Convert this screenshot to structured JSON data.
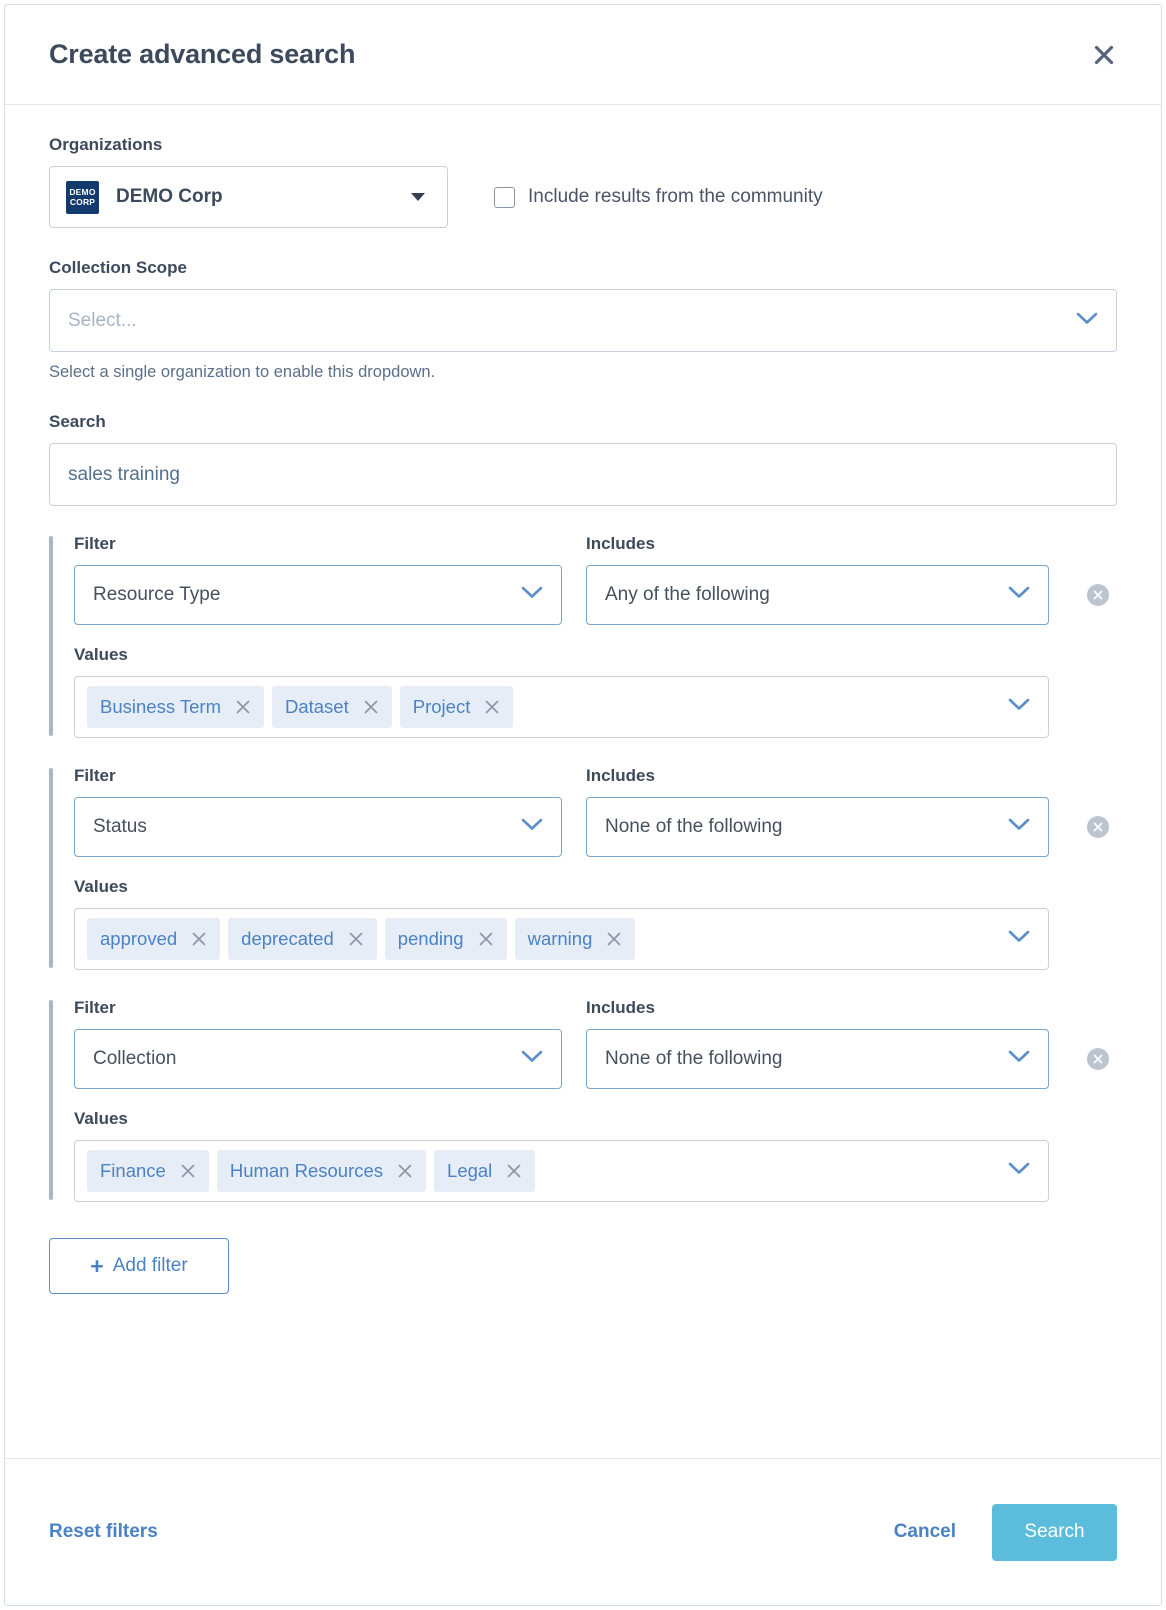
{
  "dialog": {
    "title": "Create advanced search",
    "close_icon": "close-icon"
  },
  "organizations": {
    "label": "Organizations",
    "selected": "DEMO Corp",
    "logo_line1": "DEMO",
    "logo_line2": "CORP",
    "logo_color": "#123a6b",
    "community_checkbox": {
      "label": "Include results from the community",
      "checked": false
    }
  },
  "collection_scope": {
    "label": "Collection Scope",
    "placeholder": "Select...",
    "value": "",
    "help_text": "Select a single organization to enable this dropdown."
  },
  "search": {
    "label": "Search",
    "value": "sales training"
  },
  "filters": {
    "filter_label": "Filter",
    "includes_label": "Includes",
    "values_label": "Values",
    "items": [
      {
        "filter": "Resource Type",
        "includes": "Any of the following",
        "values": [
          "Business Term",
          "Dataset",
          "Project"
        ]
      },
      {
        "filter": "Status",
        "includes": "None of the following",
        "values": [
          "approved",
          "deprecated",
          "pending",
          "warning"
        ]
      },
      {
        "filter": "Collection",
        "includes": "None of the following",
        "values": [
          "Finance",
          "Human Resources",
          "Legal"
        ]
      }
    ]
  },
  "add_filter": {
    "plus": "+",
    "label": "Add filter"
  },
  "footer": {
    "reset_label": "Reset filters",
    "cancel_label": "Cancel",
    "search_label": "Search",
    "search_button_color": "#5bbcdc"
  }
}
